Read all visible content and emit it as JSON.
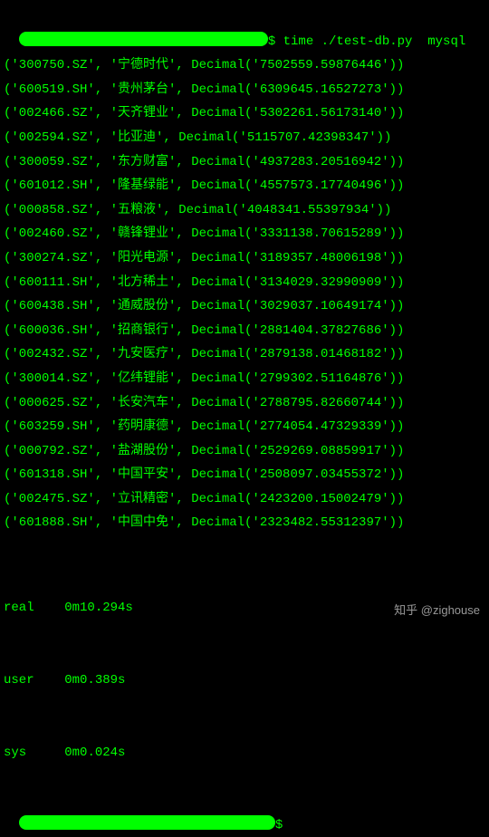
{
  "prompt": {
    "symbol1": "$",
    "command": "time ./test-db.py  mysql",
    "symbol2": "$"
  },
  "rows": [
    {
      "code": "300750.SZ",
      "name": "宁德时代",
      "value": "7502559.59876446"
    },
    {
      "code": "600519.SH",
      "name": "贵州茅台",
      "value": "6309645.16527273"
    },
    {
      "code": "002466.SZ",
      "name": "天齐锂业",
      "value": "5302261.56173140"
    },
    {
      "code": "002594.SZ",
      "name": "比亚迪",
      "value": "5115707.42398347"
    },
    {
      "code": "300059.SZ",
      "name": "东方财富",
      "value": "4937283.20516942"
    },
    {
      "code": "601012.SH",
      "name": "隆基绿能",
      "value": "4557573.17740496"
    },
    {
      "code": "000858.SZ",
      "name": "五粮液",
      "value": "4048341.55397934"
    },
    {
      "code": "002460.SZ",
      "name": "赣锋锂业",
      "value": "3331138.70615289"
    },
    {
      "code": "300274.SZ",
      "name": "阳光电源",
      "value": "3189357.48006198"
    },
    {
      "code": "600111.SH",
      "name": "北方稀土",
      "value": "3134029.32990909"
    },
    {
      "code": "600438.SH",
      "name": "通威股份",
      "value": "3029037.10649174"
    },
    {
      "code": "600036.SH",
      "name": "招商银行",
      "value": "2881404.37827686"
    },
    {
      "code": "002432.SZ",
      "name": "九安医疗",
      "value": "2879138.01468182"
    },
    {
      "code": "300014.SZ",
      "name": "亿纬锂能",
      "value": "2799302.51164876"
    },
    {
      "code": "000625.SZ",
      "name": "长安汽车",
      "value": "2788795.82660744"
    },
    {
      "code": "603259.SH",
      "name": "药明康德",
      "value": "2774054.47329339"
    },
    {
      "code": "000792.SZ",
      "name": "盐湖股份",
      "value": "2529269.08859917"
    },
    {
      "code": "601318.SH",
      "name": "中国平安",
      "value": "2508097.03455372"
    },
    {
      "code": "002475.SZ",
      "name": "立讯精密",
      "value": "2423200.15002479"
    },
    {
      "code": "601888.SH",
      "name": "中国中免",
      "value": "2323482.55312397"
    }
  ],
  "timing": {
    "real_label": "real",
    "real_value": "0m10.294s",
    "user_label": "user",
    "user_value": "0m0.389s",
    "sys_label": "sys",
    "sys_value": "0m0.024s"
  },
  "watermark": "知乎 @zighouse"
}
